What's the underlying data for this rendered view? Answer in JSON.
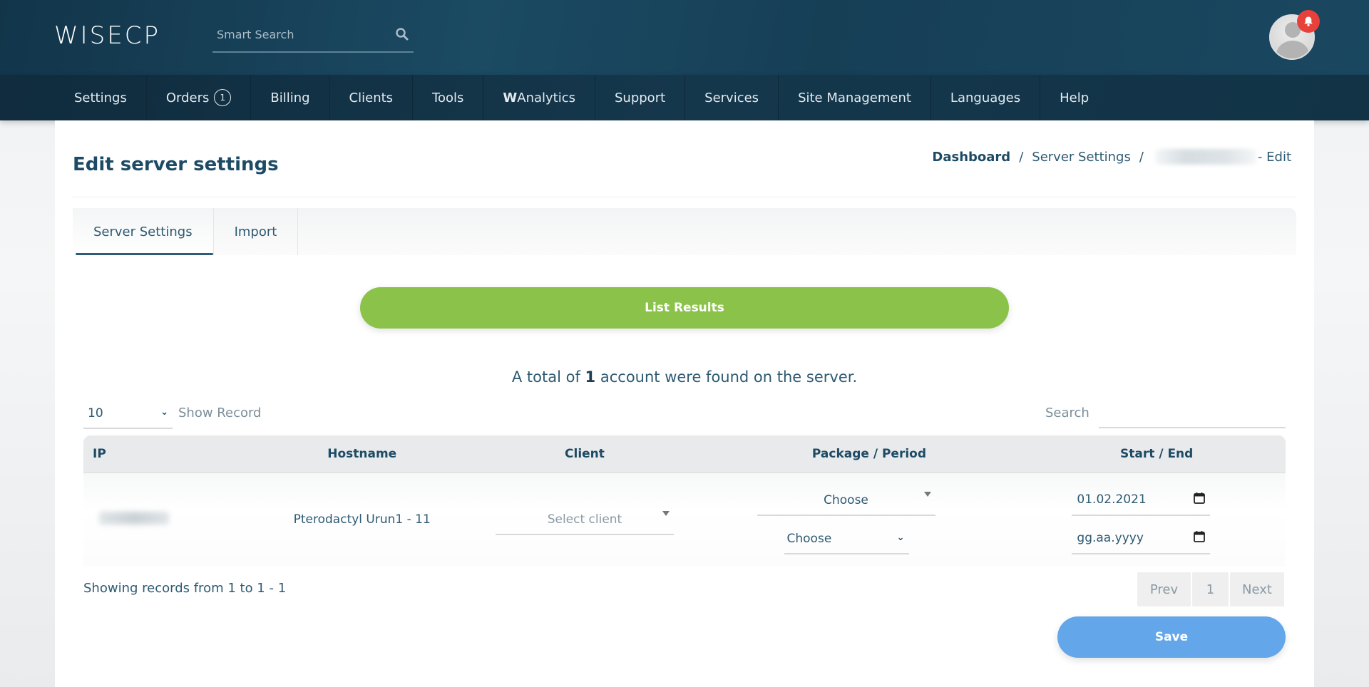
{
  "header": {
    "logo": "WISECP",
    "smart_search": {
      "placeholder": "Smart Search",
      "value": ""
    },
    "notification_icon": "bell-icon",
    "avatar_icon": "user-avatar-icon"
  },
  "nav": {
    "items": [
      {
        "label": "Settings"
      },
      {
        "label": "Orders",
        "count": "1"
      },
      {
        "label": "Billing"
      },
      {
        "label": "Clients"
      },
      {
        "label": "Tools"
      },
      {
        "label_bold": "W",
        "label": "Analytics"
      },
      {
        "label": "Support"
      },
      {
        "label": "Services"
      },
      {
        "label": "Site Management"
      },
      {
        "label": "Languages"
      },
      {
        "label": "Help"
      }
    ]
  },
  "page": {
    "title": "Edit server settings",
    "breadcrumb": {
      "home": "Dashboard",
      "separator": "/",
      "section": "Server Settings",
      "suffix": "- Edit"
    },
    "tabs": [
      {
        "label": "Server Settings",
        "active": true
      },
      {
        "label": "Import",
        "active": false
      }
    ],
    "list_results_label": "List Results",
    "total": {
      "prefix": "A total of",
      "count": "1",
      "suffix": "account were found on the server."
    },
    "table_controls": {
      "page_size": "10",
      "show_record_label": "Show Record",
      "search_label": "Search",
      "search_value": ""
    },
    "table": {
      "columns": [
        "IP",
        "Hostname",
        "Client",
        "Package / Period",
        "Start / End"
      ],
      "rows": [
        {
          "ip": "",
          "hostname": "Pterodactyl Urun1 - 11",
          "client_placeholder": "Select client",
          "package": "Choose",
          "period": "Choose",
          "start_date": "01.02.2021",
          "end_date_placeholder": "gg.aa.yyyy"
        }
      ]
    },
    "records_info": "Showing records from 1 to 1 - 1",
    "pagination": {
      "prev": "Prev",
      "current": "1",
      "next": "Next"
    },
    "save_label": "Save"
  },
  "colors": {
    "header_bg": "#1b4a63",
    "title": "#1d4b66",
    "list_results_btn": "#8bc34a",
    "save_btn": "#63a6e9",
    "notification": "#e8403a"
  }
}
